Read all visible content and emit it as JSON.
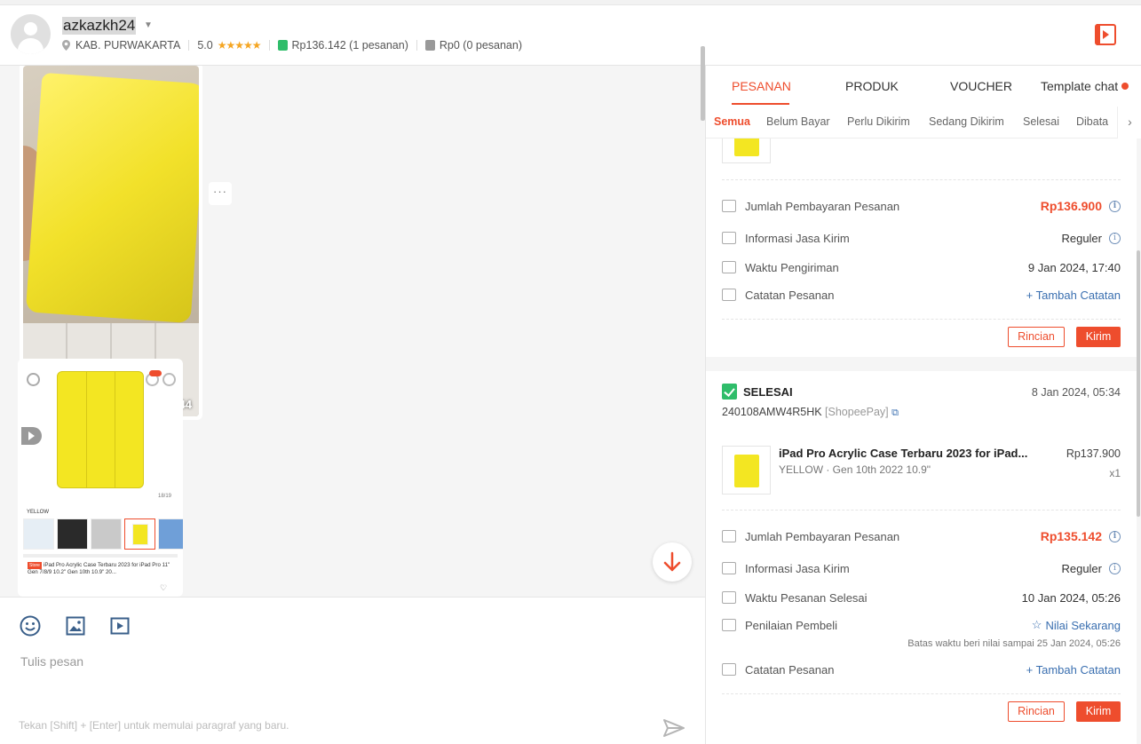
{
  "header": {
    "username": "azkazkh24",
    "location": "KAB. PURWAKARTA",
    "rating": "5.0",
    "stars": "★★★★★",
    "completed_orders": "Rp136.142 (1 pesanan)",
    "cancelled_orders": "Rp0 (0 pesanan)"
  },
  "chat": {
    "video_duration": "10:44",
    "product_card": {
      "page_counter": "18/19",
      "variant_label": "YELLOW",
      "tag": "Store",
      "title": "iPad Pro Acrylic Case Terbaru 2023 for iPad Pro 11\" Gen 7/8/9 10.2\" Gen 10th 10.9\" 20..."
    }
  },
  "composer": {
    "placeholder": "Tulis pesan",
    "hint": "Tekan [Shift] + [Enter] untuk memulai paragraf yang baru."
  },
  "panel": {
    "tabs": [
      "PESANAN",
      "PRODUK",
      "VOUCHER",
      "Template chat"
    ],
    "subtabs": [
      "Semua",
      "Belum Bayar",
      "Perlu Dikirim",
      "Sedang Dikirim",
      "Selesai",
      "Dibata"
    ],
    "order1": {
      "payment_label": "Jumlah Pembayaran Pesanan",
      "payment_value": "Rp136.900",
      "shipping_label": "Informasi Jasa Kirim",
      "shipping_value": "Reguler",
      "delivery_time_label": "Waktu Pengiriman",
      "delivery_time_value": "9 Jan 2024, 17:40",
      "note_label": "Catatan Pesanan",
      "note_action": "+ Tambah Catatan",
      "btn_detail": "Rincian",
      "btn_send": "Kirim"
    },
    "order2": {
      "status": "SELESAI",
      "date": "8 Jan 2024, 05:34",
      "order_id": "240108AMW4R5HK",
      "payment_method": "[ShopeePay]",
      "product_name": "iPad Pro Acrylic Case Terbaru 2023 for iPad...",
      "product_price": "Rp137.900",
      "product_variant": "YELLOW · Gen 10th 2022 10.9\"",
      "product_qty": "x1",
      "payment_label": "Jumlah Pembayaran Pesanan",
      "payment_value": "Rp135.142",
      "shipping_label": "Informasi Jasa Kirim",
      "shipping_value": "Reguler",
      "complete_time_label": "Waktu Pesanan Selesai",
      "complete_time_value": "10 Jan 2024, 05:26",
      "rating_label": "Penilaian Pembeli",
      "rating_action": "Nilai Sekarang",
      "rating_deadline": "Batas waktu beri nilai sampai 25 Jan 2024, 05:26",
      "note_label": "Catatan Pesanan",
      "note_action": "+ Tambah Catatan",
      "btn_detail": "Rincian",
      "btn_send": "Kirim"
    }
  }
}
